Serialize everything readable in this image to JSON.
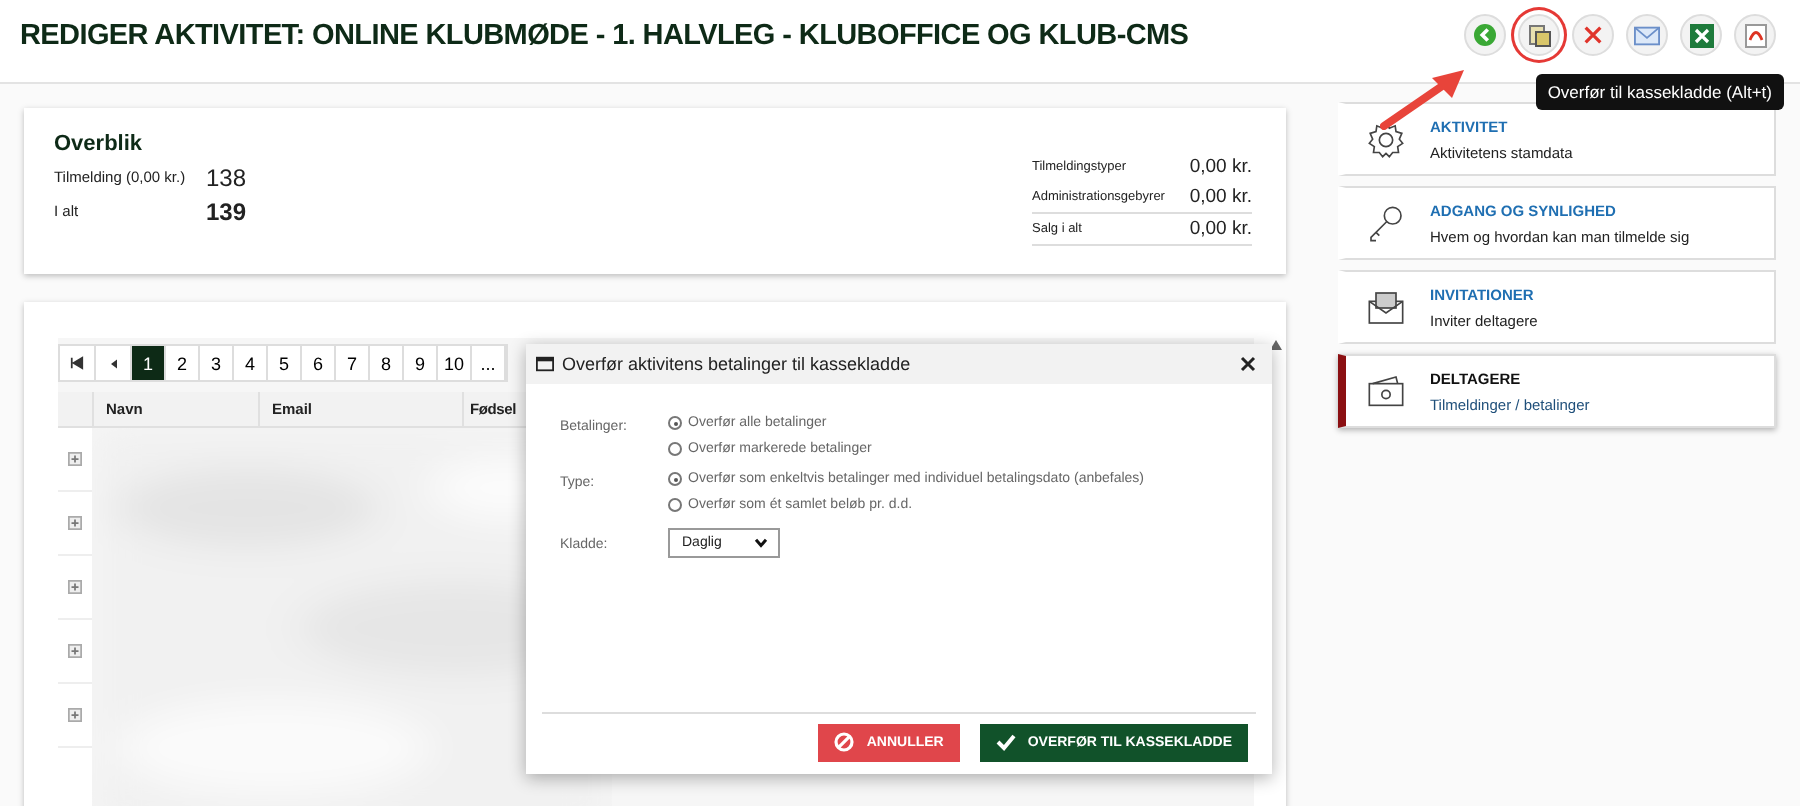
{
  "header": {
    "title": "REDIGER AKTIVITET: ONLINE KLUBMØDE - 1. HALVLEG - KLUBOFFICE OG KLUB-CMS",
    "actions": [
      {
        "kind": "back",
        "highlighted": false
      },
      {
        "kind": "transfer",
        "highlighted": true
      },
      {
        "kind": "delete",
        "highlighted": false
      },
      {
        "kind": "mail",
        "highlighted": false
      },
      {
        "kind": "excel",
        "highlighted": false
      },
      {
        "kind": "pdf",
        "highlighted": false
      }
    ],
    "tooltip": "Overfør til kassekladde (Alt+t)"
  },
  "overview": {
    "title": "Overblik",
    "left": [
      {
        "label": "Tilmelding (0,00 kr.)",
        "value": "138",
        "bold": false
      },
      {
        "label": "I alt",
        "value": "139",
        "bold": true
      }
    ],
    "right": [
      {
        "label": "Tilmeldingstyper",
        "value": "0,00 kr."
      },
      {
        "label": "Administrationsgebyrer",
        "value": "0,00 kr."
      },
      {
        "label": "Salg i alt",
        "value": "0,00 kr."
      }
    ]
  },
  "table": {
    "pages": [
      {
        "label": "1",
        "selected": true
      },
      {
        "label": "2",
        "selected": false
      },
      {
        "label": "3",
        "selected": false
      },
      {
        "label": "4",
        "selected": false
      },
      {
        "label": "5",
        "selected": false
      },
      {
        "label": "6",
        "selected": false
      },
      {
        "label": "7",
        "selected": false
      },
      {
        "label": "8",
        "selected": false
      },
      {
        "label": "9",
        "selected": false
      },
      {
        "label": "10",
        "selected": false
      },
      {
        "label": "...",
        "selected": false
      }
    ],
    "columns": [
      "Navn",
      "Email",
      "Fødsel"
    ],
    "rows": [
      {
        "expanded": false
      },
      {
        "expanded": false
      },
      {
        "expanded": false
      },
      {
        "expanded": false
      },
      {
        "expanded": false
      }
    ]
  },
  "sidebar": {
    "items": [
      {
        "kind": "gear",
        "title": "AKTIVITET",
        "subtitle": "Aktivitetens stamdata",
        "selected": false
      },
      {
        "kind": "key",
        "title": "ADGANG OG SYNLIGHED",
        "subtitle": "Hvem og hvordan kan man tilmelde sig",
        "selected": false
      },
      {
        "kind": "envelope",
        "title": "INVITATIONER",
        "subtitle": "Inviter deltagere",
        "selected": false
      },
      {
        "kind": "wallet",
        "title": "DELTAGERE",
        "subtitle": "Tilmeldinger / betalinger",
        "selected": true
      }
    ]
  },
  "dialog": {
    "title": "Overfør aktivitens betalinger til kassekladde",
    "groups": [
      {
        "label": "Betalinger:",
        "options": [
          {
            "label": "Overfør alle betalinger",
            "selected": true
          },
          {
            "label": "Overfør markerede betalinger",
            "selected": false
          }
        ]
      },
      {
        "label": "Type:",
        "options": [
          {
            "label": "Overfør som enkeltvis betalinger med individuel betalingsdato (anbefales)",
            "selected": true
          },
          {
            "label": "Overfør som ét samlet beløb pr. d.d.",
            "selected": false
          }
        ]
      }
    ],
    "select": {
      "label": "Kladde:",
      "value": "Daglig"
    },
    "cancel": "ANNULLER",
    "confirm": "OVERFØR TIL KASSEKLADDE"
  }
}
